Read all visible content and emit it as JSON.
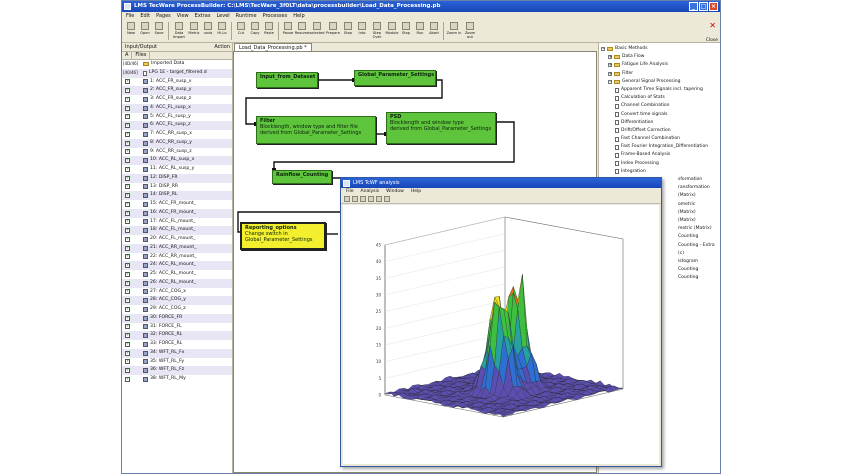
{
  "app": {
    "title": "LMS TecWare ProcessBuilder: C:\\LMS\\TecWare_3f0LT\\data\\processbuilder\\Load_Data_Processing.pb",
    "close_label": "Close"
  },
  "menubar": [
    "File",
    "Edit",
    "Pages",
    "View",
    "Extras",
    "Level",
    "Runtime",
    "Processes",
    "Help"
  ],
  "toolbar": [
    "New",
    "Open",
    "Save",
    "Data Import",
    "Metric",
    "unds",
    "Hi-Lo",
    "Cut",
    "Copy",
    "Paste",
    "Pause",
    "Resume",
    "selected",
    "Prepare",
    "Step",
    "Into",
    "Step Over",
    "Module",
    "Stop",
    "Run",
    "Abort",
    "Zoom in",
    "Zoom out"
  ],
  "left_panel": {
    "title": "Input/Output",
    "action_label": "Action",
    "tabs": [
      "A",
      "Files"
    ],
    "selector": [
      "[4D/46]",
      "[40/46]"
    ],
    "root_label": "Imported Data",
    "group_label": "LPG 1E - target_filtered.d",
    "channels": [
      "1: ACC_FR_susp_x",
      "2: ACC_FR_susp_y",
      "3: ACC_FR_susp_z",
      "4: ACC_FL_susp_x",
      "5: ACC_FL_susp_y",
      "6: ACC_FL_susp_z",
      "7: ACC_RR_susp_x",
      "8: ACC_RR_susp_y",
      "9: ACC_RR_susp_z",
      "10: ACC_RL_susp_x",
      "11: ACC_RL_susp_y",
      "12: DISP_FR",
      "13: DISP_RR",
      "14: DISP_RL",
      "15: ACC_FR_mount_",
      "16: ACC_FR_mount_",
      "17: ACC_FL_mount_",
      "18: ACC_FL_mount_",
      "20: ACC_FL_mount_",
      "21: ACC_RR_mount_",
      "22: ACC_RR_mount_",
      "24: ACC_RL_mount_",
      "25: ACC_RL_mount_",
      "26: ACC_RL_mount_",
      "27: ACC_COG_x",
      "28: ACC_COG_y",
      "29: ACC_COG_z",
      "30: FORCE_FR",
      "31: FORCE_FL",
      "32: FORCE_RL",
      "33: FORCE_RL",
      "34: WFT_RL_Fx",
      "35: WFT_RL_Fy",
      "36: WFT_RL_Fz",
      "38: WFT_RL_My"
    ]
  },
  "doc_tab": "Load_Data_Processing.pb *",
  "nodes": [
    {
      "id": "input",
      "title": "Input_from_Dataset",
      "lines": []
    },
    {
      "id": "global",
      "title": "Global_Parameter_Settings",
      "lines": []
    },
    {
      "id": "filter",
      "title": "Filter",
      "lines": [
        "Blocklength, window type and filter file",
        "derived from Global_Parameter_Settings"
      ]
    },
    {
      "id": "psd",
      "title": "PSD",
      "lines": [
        "Blocklength and window type",
        "derived from Global_Parameter_Settings"
      ]
    },
    {
      "id": "rainflow",
      "title": "Rainflow_Counting",
      "lines": []
    },
    {
      "id": "report",
      "title": "Reporting_options",
      "lines": [
        "Change switch in",
        "Global_Parameter_Settings"
      ]
    }
  ],
  "right_panel": {
    "items": [
      {
        "label": "Basic Methods",
        "level": 0
      },
      {
        "label": "Data Flow",
        "level": 1
      },
      {
        "label": "Fatigue Life Analysis",
        "level": 1
      },
      {
        "label": "Filter",
        "level": 1
      },
      {
        "label": "General Signal Processing",
        "level": 1
      },
      {
        "label": "Apparent Time Signals incl. tapering",
        "level": 2
      },
      {
        "label": "Calculation of Stats",
        "level": 2
      },
      {
        "label": "Channel Combination",
        "level": 2
      },
      {
        "label": "Convert time signals",
        "level": 2
      },
      {
        "label": "Differentiation",
        "level": 2
      },
      {
        "label": "Drift/Offset Correction",
        "level": 2
      },
      {
        "label": "Fast Channel Combination",
        "level": 2
      },
      {
        "label": "Fast Fourier Integration_Differentiation",
        "level": 2
      },
      {
        "label": "Frame-Based Analysis",
        "level": 2
      },
      {
        "label": "Index Processing",
        "level": 2
      },
      {
        "label": "Integration",
        "level": 2
      },
      {
        "label": "sformation",
        "level": 3
      },
      {
        "label": "ransformation",
        "level": 3
      },
      {
        "label": "(Matrix)",
        "level": 3
      },
      {
        "label": "ometric",
        "level": 3
      },
      {
        "label": "(Matrix)",
        "level": 3
      },
      {
        "label": "(Matrix)",
        "level": 3
      },
      {
        "label": "metric (Matrix)",
        "level": 3
      },
      {
        "label": "Counting",
        "level": 3
      },
      {
        "label": "Counting - Extra",
        "level": 3
      },
      {
        "label": "(c)",
        "level": 3
      },
      {
        "label": "istogram",
        "level": 3
      },
      {
        "label": "Counting",
        "level": 3
      },
      {
        "label": "Counting",
        "level": 3
      }
    ]
  },
  "plot_window": {
    "title": "LMS TcWF analysis",
    "menu": [
      "File",
      "Analysis",
      "Window",
      "Help"
    ]
  },
  "chart_data": {
    "type": "surface3d",
    "title": "",
    "z_ticks": [
      0,
      5,
      10,
      15,
      20,
      25,
      30,
      35,
      40,
      45
    ],
    "colormap": [
      "#5a4fb0",
      "#2f6fd0",
      "#26a0a0",
      "#3fbf3f",
      "#f0e020",
      "#e07020",
      "#d02020"
    ],
    "peaks": [
      {
        "name": "",
        "x": 0.42,
        "y": 0.46,
        "height": 45
      },
      {
        "name": "",
        "x": 0.6,
        "y": 0.5,
        "height": 40
      }
    ]
  }
}
